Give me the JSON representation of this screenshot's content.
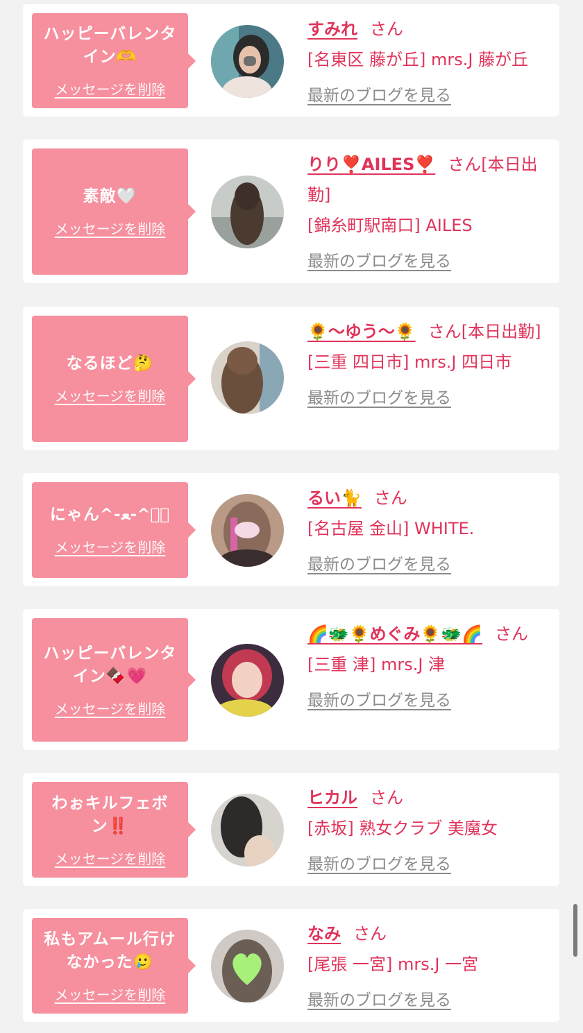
{
  "colors": {
    "page_bg": "#f2f2f2",
    "card_bg": "#ffffff",
    "bubble_bg": "#f68f9e",
    "name_text": "#e0335a",
    "blog_link": "#8a8a8a"
  },
  "messages": [
    {
      "message": "ハッピーバレンタイン🫶",
      "delete_label": "メッセージを削除",
      "name": "すみれ",
      "honorific": "さん",
      "shop": "[名東区 藤が丘] mrs.J 藤が丘",
      "blog_label": "最新のブログを見る",
      "avatar_icon": "avatar-photo-icon"
    },
    {
      "message": "素敵🤍",
      "delete_label": "メッセージを削除",
      "name": "りり❣️AILES❣️",
      "honorific": "さん[本日出勤]",
      "shop": "[錦糸町駅南口] AILES",
      "blog_label": "最新のブログを見る",
      "avatar_icon": "avatar-photo-icon"
    },
    {
      "message": "なるほど🤔",
      "delete_label": "メッセージを削除",
      "name": "🌻〜ゆう〜🌻",
      "honorific": "さん[本日出勤]",
      "shop": "[三重 四日市] mrs.J 四日市",
      "blog_label": "最新のブログを見る",
      "avatar_icon": "avatar-photo-icon"
    },
    {
      "message": "にゃん^-ﻌ-^ฅ゙",
      "delete_label": "メッセージを削除",
      "name": "るい🐈",
      "honorific": "さん",
      "shop": "[名古屋 金山] WHITE.",
      "blog_label": "最新のブログを見る",
      "avatar_icon": "avatar-photo-icon"
    },
    {
      "message": "ハッピーバレンタイン🍫💗",
      "delete_label": "メッセージを削除",
      "name": "🌈🐲🌻めぐみ🌻🐲🌈",
      "honorific": "さん",
      "shop": "[三重 津] mrs.J 津",
      "blog_label": "最新のブログを見る",
      "avatar_icon": "avatar-photo-icon"
    },
    {
      "message": "わぉキルフェボン‼️",
      "delete_label": "メッセージを削除",
      "name": "ヒカル",
      "honorific": "さん",
      "shop": "[赤坂] 熟女クラブ 美魔女",
      "blog_label": "最新のブログを見る",
      "avatar_icon": "avatar-photo-icon"
    },
    {
      "message": "私もアムール行けなかった🥲",
      "delete_label": "メッセージを削除",
      "name": "なみ",
      "honorific": "さん",
      "shop": "[尾張 一宮] mrs.J 一宮",
      "blog_label": "最新のブログを見る",
      "avatar_icon": "avatar-photo-icon"
    }
  ]
}
